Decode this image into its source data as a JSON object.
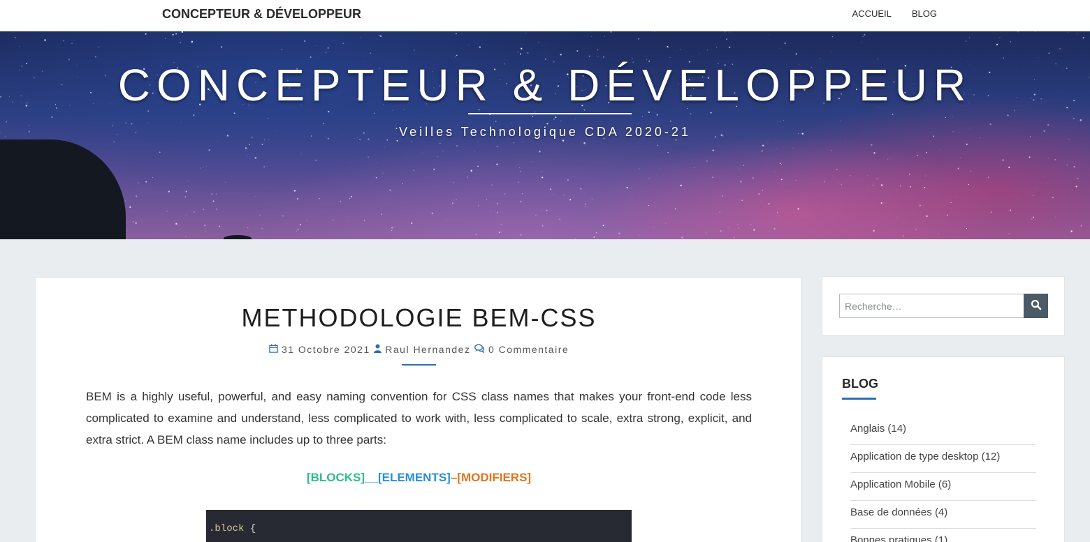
{
  "topbar": {
    "site_title": "CONCEPTEUR & DÉVELOPPEUR",
    "nav": [
      {
        "label": "ACCUEIL"
      },
      {
        "label": "BLOG"
      }
    ]
  },
  "hero": {
    "title": "CONCEPTEUR & DÉVELOPPEUR",
    "subtitle": "Veilles Technologique CDA 2020-21"
  },
  "article": {
    "title": "METHODOLOGIE BEM-CSS",
    "date": "31 Octobre 2021",
    "author": "Raul Hernandez",
    "comments": "0 Commentaire",
    "body": "BEM is a highly useful, powerful, and easy naming convention for CSS class names that makes your front-end code less complicated to examine and understand, less complicated to work with, less complicated to scale, extra strong, explicit, and extra strict. A BEM class name includes up to three parts:",
    "bem": {
      "blocks": "[BLOCKS]",
      "sep1": "__",
      "elements": "[ELEMENTS]",
      "sep2": "–",
      "modifiers": "[MODIFIERS]"
    },
    "code": {
      "selector": ".block",
      "brace": "{"
    }
  },
  "sidebar": {
    "search_placeholder": "Recherche…",
    "blog_title": "BLOG",
    "categories": [
      {
        "name": "Anglais",
        "count": "(14)"
      },
      {
        "name": "Application de type desktop",
        "count": "(12)"
      },
      {
        "name": "Application Mobile",
        "count": "(6)"
      },
      {
        "name": "Base de données",
        "count": "(4)"
      },
      {
        "name": "Bonnes pratiques",
        "count": "(1)"
      }
    ]
  },
  "colors": {
    "accent": "#2a6fb4",
    "bem_blocks": "#2fbf86",
    "bem_elements": "#2a8fd8",
    "bem_modifiers": "#e0751f"
  },
  "icons": {
    "date": "calendar-icon",
    "author": "user-icon",
    "comments": "comments-icon",
    "search": "search-icon"
  }
}
